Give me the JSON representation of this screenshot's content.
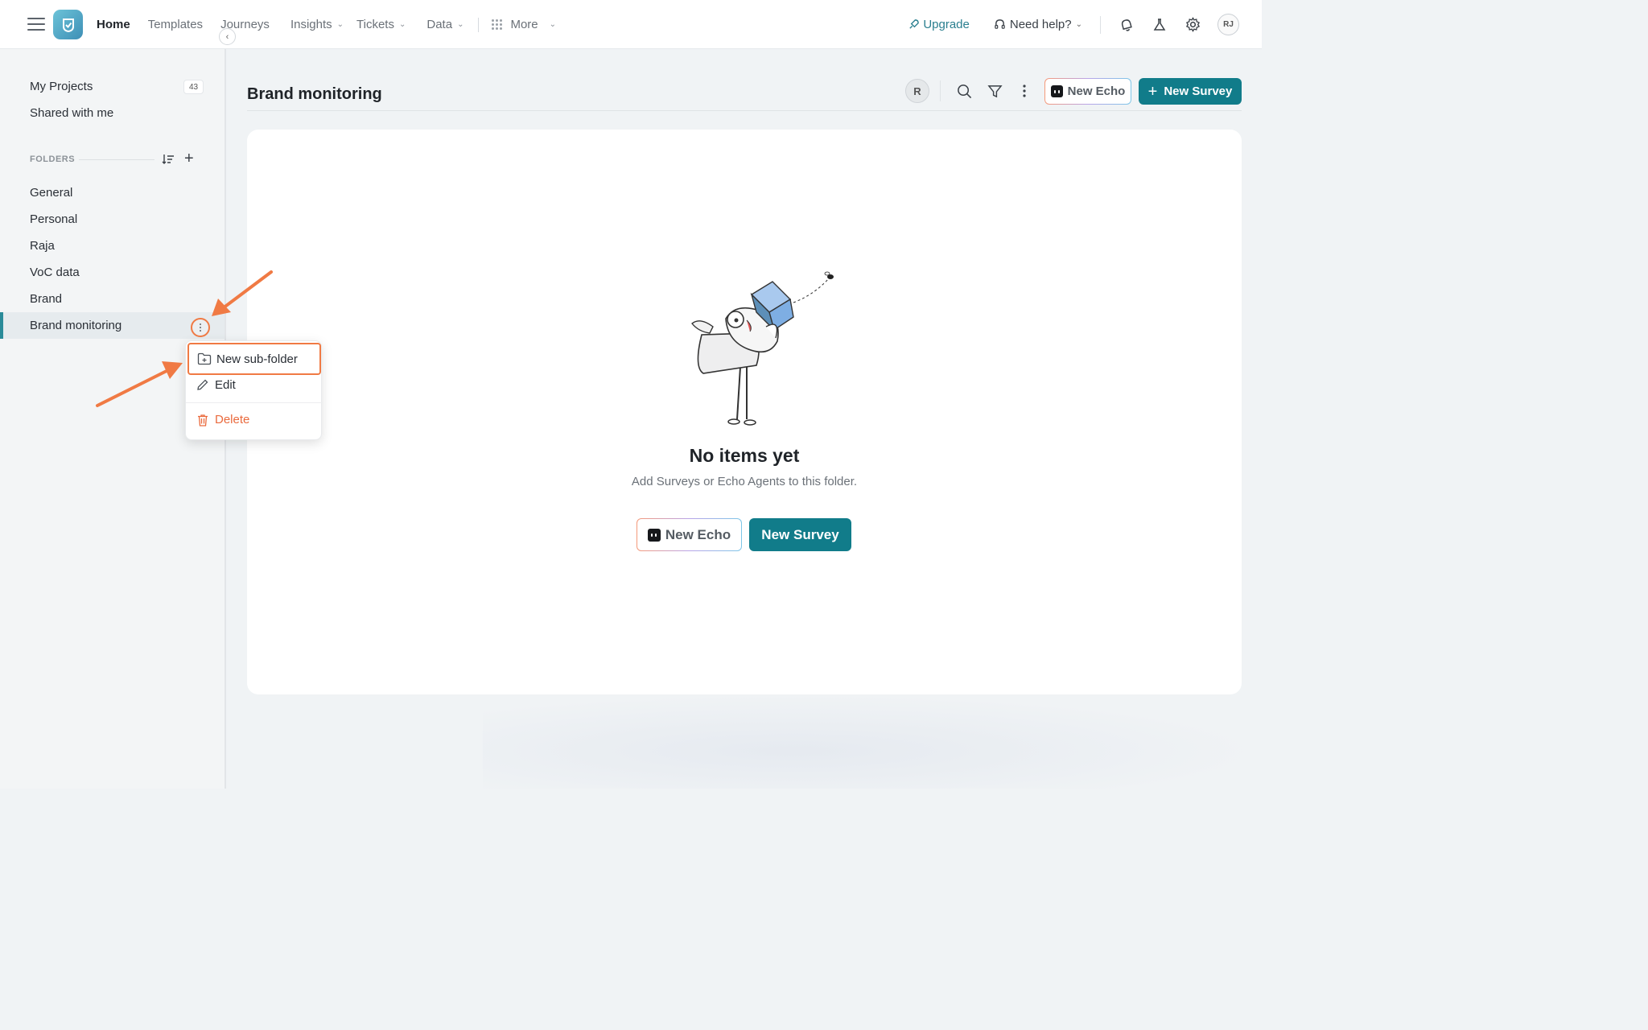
{
  "topnav": {
    "items": [
      {
        "label": "Home",
        "active": true
      },
      {
        "label": "Templates"
      },
      {
        "label": "Journeys"
      },
      {
        "label": "Insights",
        "dropdown": true
      },
      {
        "label": "Tickets",
        "dropdown": true
      },
      {
        "label": "Data",
        "dropdown": true
      }
    ],
    "more_label": "More",
    "upgrade_label": "Upgrade",
    "help_label": "Need help?",
    "user_initials": "RJ"
  },
  "sidebar": {
    "my_projects": "My Projects",
    "my_projects_count": "43",
    "shared": "Shared with me",
    "folders_heading": "FOLDERS",
    "folders": [
      "General",
      "Personal",
      "Raja",
      "VoC data",
      "Brand",
      "Brand monitoring"
    ],
    "active_folder": "Brand monitoring"
  },
  "context_menu": {
    "new_subfolder": "New sub-folder",
    "edit": "Edit",
    "delete": "Delete"
  },
  "main": {
    "title": "Brand monitoring",
    "owner_initial": "R",
    "new_echo_label": "New Echo",
    "new_survey_label": "New Survey",
    "empty_title": "No items yet",
    "empty_subtitle": "Add Surveys or Echo Agents to this folder."
  },
  "colors": {
    "accent": "#117c8a",
    "annotation": "#f07a44",
    "delete": "#ea6a3d"
  }
}
